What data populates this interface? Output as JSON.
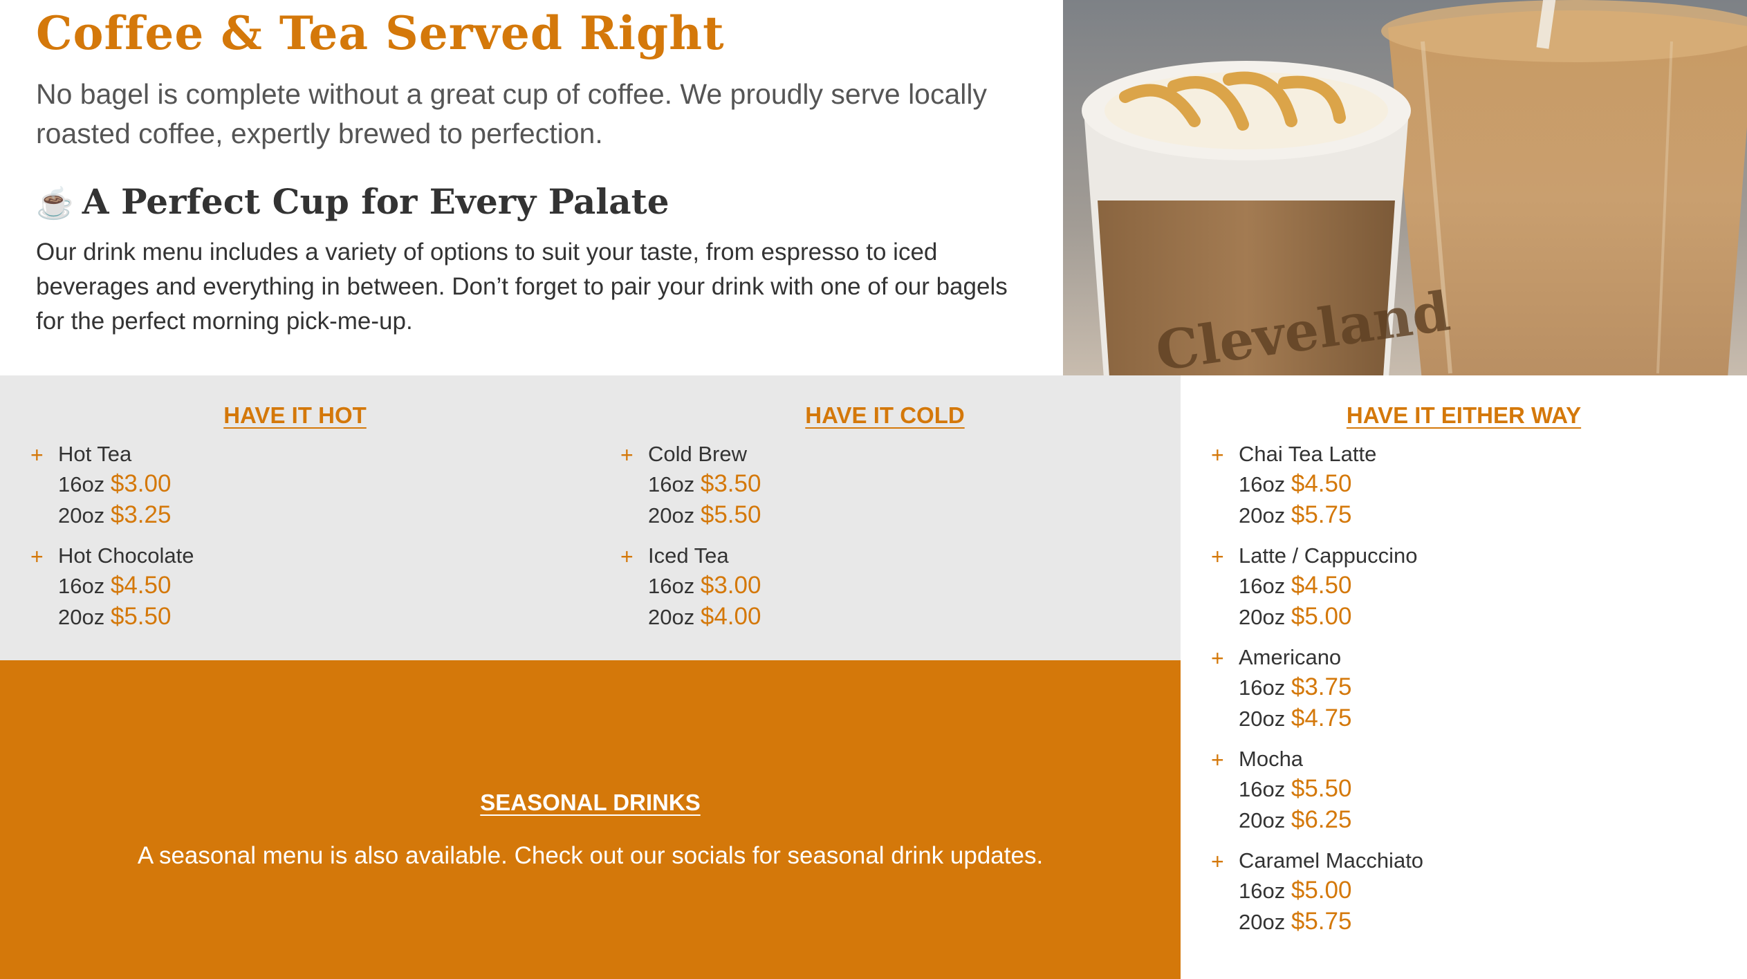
{
  "intro": {
    "title": "Coffee & Tea Served Right",
    "lead": "No bagel is complete without a great cup of coffee. We proudly serve locally roasted coffee, expertly brewed to perfection.",
    "subhead_icon": "☕",
    "subhead": "A Perfect Cup for Every Palate",
    "body": "Our drink menu includes a variety of options to suit your taste, from espresso to iced beverages and everything in between. Don’t forget to pair your drink with one of our bagels for the perfect morning pick-me-up."
  },
  "photo": {
    "sleeve_text": "Cleveland"
  },
  "menu": {
    "hot": {
      "heading": "HAVE IT HOT",
      "items": [
        {
          "name": "Hot Tea",
          "sizes": [
            {
              "size": "16oz",
              "price": "$3.00"
            },
            {
              "size": "20oz",
              "price": "$3.25"
            }
          ]
        },
        {
          "name": "Hot Chocolate",
          "sizes": [
            {
              "size": "16oz",
              "price": "$4.50"
            },
            {
              "size": "20oz",
              "price": "$5.50"
            }
          ]
        }
      ]
    },
    "cold": {
      "heading": "HAVE IT COLD",
      "items": [
        {
          "name": "Cold Brew",
          "sizes": [
            {
              "size": "16oz",
              "price": "$3.50"
            },
            {
              "size": "20oz",
              "price": "$5.50"
            }
          ]
        },
        {
          "name": "Iced Tea",
          "sizes": [
            {
              "size": "16oz",
              "price": "$3.00"
            },
            {
              "size": "20oz",
              "price": "$4.00"
            }
          ]
        }
      ]
    },
    "either": {
      "heading": "HAVE IT EITHER WAY",
      "items": [
        {
          "name": "Chai Tea Latte",
          "sizes": [
            {
              "size": "16oz",
              "price": "$4.50"
            },
            {
              "size": "20oz",
              "price": "$5.75"
            }
          ]
        },
        {
          "name": "Latte / Cappuccino",
          "sizes": [
            {
              "size": "16oz",
              "price": "$4.50"
            },
            {
              "size": "20oz",
              "price": "$5.00"
            }
          ]
        },
        {
          "name": "Americano",
          "sizes": [
            {
              "size": "16oz",
              "price": "$3.75"
            },
            {
              "size": "20oz",
              "price": "$4.75"
            }
          ]
        },
        {
          "name": "Mocha",
          "sizes": [
            {
              "size": "16oz",
              "price": "$5.50"
            },
            {
              "size": "20oz",
              "price": "$6.25"
            }
          ]
        },
        {
          "name": "Caramel Macchiato",
          "sizes": [
            {
              "size": "16oz",
              "price": "$5.00"
            },
            {
              "size": "20oz",
              "price": "$5.75"
            }
          ]
        }
      ]
    },
    "plus_icon": "+"
  },
  "seasonal": {
    "heading": "SEASONAL DRINKS",
    "text": "A seasonal menu is also available. Check out our socials for seasonal drink updates."
  },
  "colors": {
    "accent": "#d4780a",
    "panel_gray": "#e8e8e8",
    "text_dark": "#333333"
  }
}
